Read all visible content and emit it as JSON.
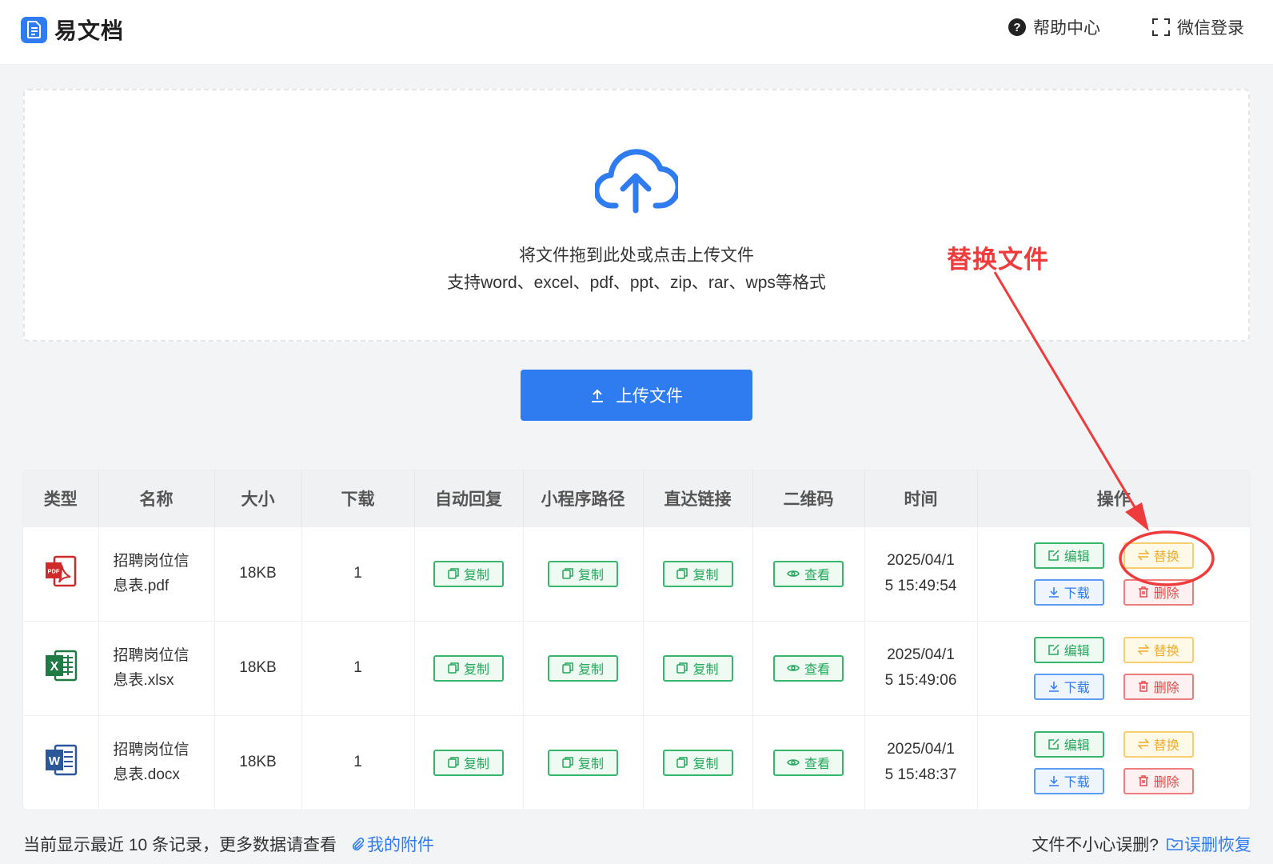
{
  "header": {
    "app_name": "易文档",
    "help_label": "帮助中心",
    "login_label": "微信登录"
  },
  "upload": {
    "hint_line1": "将文件拖到此处或点击上传文件",
    "hint_line2": "支持word、excel、pdf、ppt、zip、rar、wps等格式",
    "button_label": "上传文件"
  },
  "table": {
    "columns": [
      "类型",
      "名称",
      "大小",
      "下载",
      "自动回复",
      "小程序路径",
      "直达链接",
      "二维码",
      "时间",
      "操作"
    ],
    "copy_label": "复制",
    "view_label": "查看",
    "actions": {
      "edit": "编辑",
      "replace": "替换",
      "download": "下载",
      "delete": "删除"
    },
    "rows": [
      {
        "type": "pdf",
        "name_line1": "招聘岗位信",
        "name_line2": "息表.pdf",
        "size": "18KB",
        "downloads": "1",
        "time_line1": "2025/04/1",
        "time_line2": "5 15:49:54"
      },
      {
        "type": "xlsx",
        "name_line1": "招聘岗位信",
        "name_line2": "息表.xlsx",
        "size": "18KB",
        "downloads": "1",
        "time_line1": "2025/04/1",
        "time_line2": "5 15:49:06"
      },
      {
        "type": "docx",
        "name_line1": "招聘岗位信",
        "name_line2": "息表.docx",
        "size": "18KB",
        "downloads": "1",
        "time_line1": "2025/04/1",
        "time_line2": "5 15:48:37"
      }
    ]
  },
  "footer": {
    "left_text": "当前显示最近 10 条记录，更多数据请查看",
    "left_link": "我的附件",
    "right_text": "文件不小心误删?",
    "right_link": "误删恢复"
  },
  "annotation": {
    "label": "替换文件"
  },
  "icons": {
    "logo": "document-icon",
    "help": "question-circle-icon",
    "login": "scan-frame-icon",
    "upload": "cloud-upload-icon"
  },
  "colors": {
    "primary": "#2f7bf0",
    "green": "#25a85c",
    "yellow": "#f0ad2a",
    "red": "#e64a4a",
    "annotation": "#ef3b3b"
  }
}
